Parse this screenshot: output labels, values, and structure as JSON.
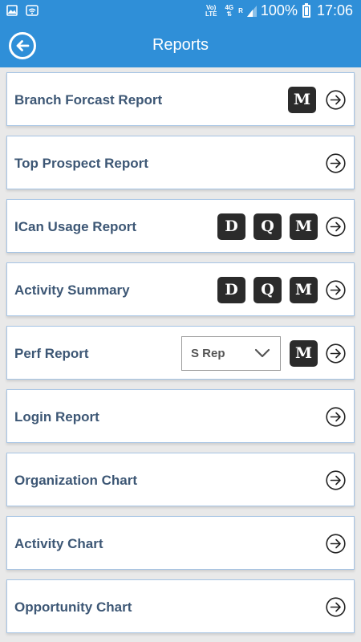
{
  "status_bar": {
    "network_top": "Vo)",
    "network_bottom": "LTE",
    "signal_4g": "4G",
    "signal_r": "R",
    "battery": "100%",
    "time": "17:06"
  },
  "app_bar": {
    "title": "Reports"
  },
  "reports": [
    {
      "label": "Branch Forcast Report",
      "badges": [
        "M"
      ]
    },
    {
      "label": "Top Prospect Report",
      "badges": []
    },
    {
      "label": "ICan Usage Report",
      "badges": [
        "D",
        "Q",
        "M"
      ]
    },
    {
      "label": "Activity Summary",
      "badges": [
        "D",
        "Q",
        "M"
      ]
    },
    {
      "label": "Perf Report",
      "badges": [
        "M"
      ],
      "select_value": "S Rep"
    },
    {
      "label": "Login Report",
      "badges": []
    },
    {
      "label": "Organization Chart",
      "badges": []
    },
    {
      "label": "Activity Chart",
      "badges": []
    },
    {
      "label": "Opportunity Chart",
      "badges": []
    }
  ],
  "colors": {
    "primary": "#2f8fd8",
    "label": "#3d5775",
    "row_border": "#a6c4e4",
    "badge": "#2b2b2b"
  },
  "icons": {
    "back": "back-circle-arrow-icon",
    "row_arrow": "circle-arrow-right-icon",
    "select_chevron": "chevron-down-icon"
  }
}
